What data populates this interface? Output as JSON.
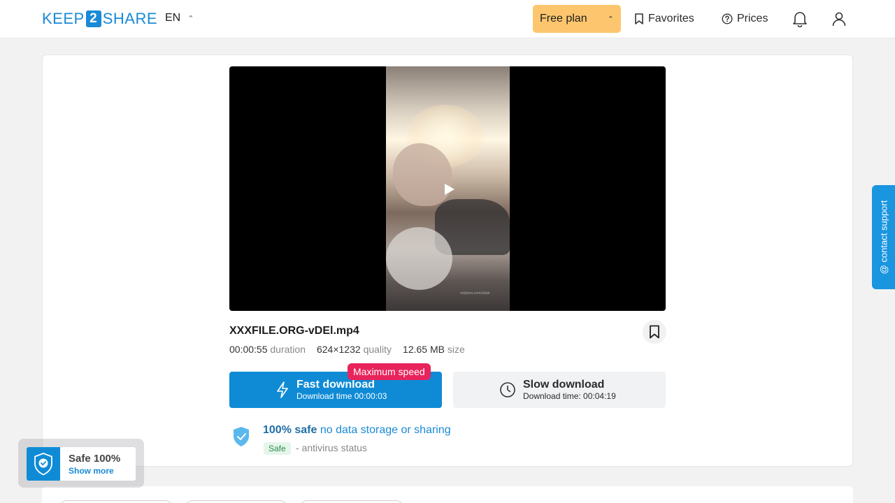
{
  "header": {
    "logo_left": "KEEP",
    "logo_mid": "2",
    "logo_right": "SHARE",
    "language": "EN",
    "plan_label": "Free plan",
    "favorites_label": "Favorites",
    "prices_label": "Prices"
  },
  "video": {
    "watermark": "onlyfans.com/a3wk"
  },
  "file": {
    "name": "XXXFILE.ORG-vDEl.mp4",
    "duration_value": "00:00:55",
    "duration_label": "duration",
    "quality_value": "624×1232",
    "quality_label": "quality",
    "size_value": "12.65 MB",
    "size_label": "size"
  },
  "download": {
    "fast_title": "Fast download",
    "fast_sub": "Download time 00:00:03",
    "badge": "Maximum speed",
    "slow_title": "Slow download",
    "slow_sub": "Download time: 00:04:19"
  },
  "safety": {
    "bold": "100% safe",
    "rest": "no data storage or sharing",
    "badge": "Safe",
    "status": "- antivirus status"
  },
  "widget": {
    "title": "Safe 100%",
    "link": "Show more"
  },
  "support": {
    "label": "@ contact support"
  },
  "colors": {
    "accent": "#0f8bd6",
    "plan": "#fdc66e",
    "badge": "#e8245c"
  }
}
